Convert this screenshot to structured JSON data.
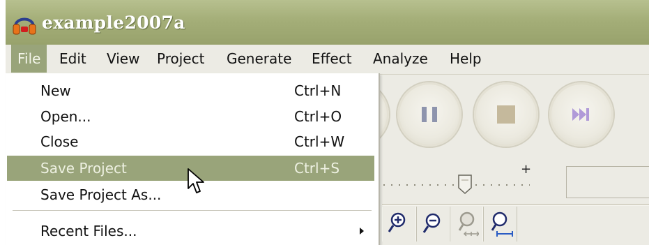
{
  "window": {
    "title": "example2007a",
    "app_icon": "headphones-icon"
  },
  "menubar": {
    "items": [
      {
        "label": "File",
        "active": true
      },
      {
        "label": "Edit"
      },
      {
        "label": "View"
      },
      {
        "label": "Project"
      },
      {
        "label": "Generate"
      },
      {
        "label": "Effect"
      },
      {
        "label": "Analyze"
      },
      {
        "label": "Help"
      }
    ]
  },
  "file_menu": {
    "items": [
      {
        "label": "New",
        "shortcut": "Ctrl+N"
      },
      {
        "label": "Open...",
        "shortcut": "Ctrl+O"
      },
      {
        "label": "Close",
        "shortcut": "Ctrl+W"
      },
      {
        "label": "Save Project",
        "shortcut": "Ctrl+S",
        "highlighted": true
      },
      {
        "label": "Save Project As...",
        "shortcut": ""
      },
      {
        "label": "Recent Files...",
        "submenu": true
      }
    ]
  },
  "toolbar": {
    "transport_icons": [
      "pause-icon",
      "stop-icon",
      "skip-to-end-icon"
    ],
    "zoom_icons": [
      "zoom-in-icon",
      "zoom-out-icon",
      "fit-selection-icon",
      "fit-project-icon"
    ],
    "slider_plus": "+"
  },
  "colors": {
    "highlight": "#99a47a",
    "titlebar": "#a4ae78",
    "background": "#ecebe4"
  }
}
